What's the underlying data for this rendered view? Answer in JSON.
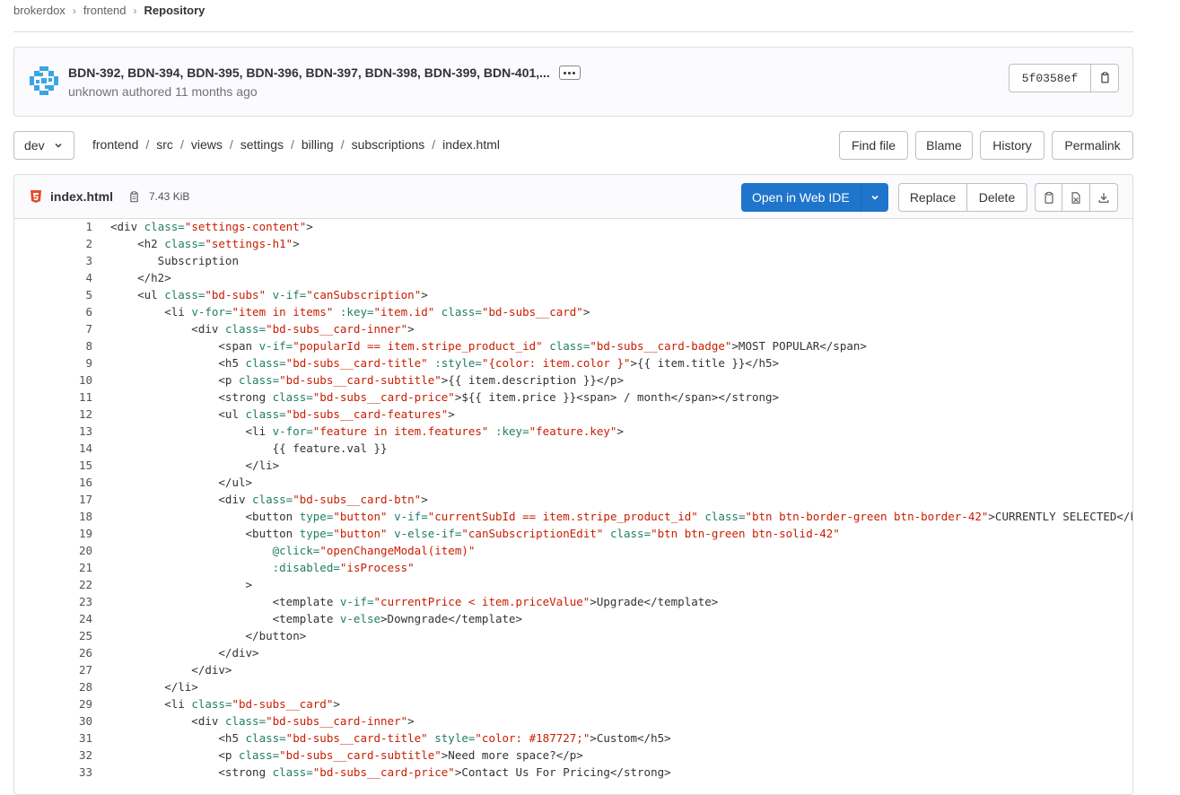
{
  "breadcrumbs": [
    "brokerdox",
    "frontend",
    "Repository"
  ],
  "commit": {
    "title": "BDN-392, BDN-394, BDN-395, BDN-396, BDN-397, BDN-398, BDN-399, BDN-401,...",
    "author_line": "unknown authored 11 months ago",
    "sha": "5f0358ef"
  },
  "nav": {
    "branch": "dev",
    "path": [
      "frontend",
      "src",
      "views",
      "settings",
      "billing",
      "subscriptions",
      "index.html"
    ],
    "buttons": {
      "find": "Find file",
      "blame": "Blame",
      "history": "History",
      "permalink": "Permalink"
    }
  },
  "file": {
    "name": "index.html",
    "size": "7.43 KiB",
    "open_ide": "Open in Web IDE",
    "replace": "Replace",
    "delete": "Delete"
  },
  "colors": {
    "primary": "#1f75cb",
    "tag": "#333238",
    "attr": "#1f7d66",
    "value": "#c91c00"
  },
  "lines": [
    [
      [
        "t",
        "<div "
      ],
      [
        "a",
        "class="
      ],
      [
        "v",
        "\"settings-content\""
      ],
      [
        "t",
        ">"
      ]
    ],
    [
      [
        "t",
        "    <h2 "
      ],
      [
        "a",
        "class="
      ],
      [
        "v",
        "\"settings-h1\""
      ],
      [
        "t",
        ">"
      ]
    ],
    [
      [
        "t",
        "       Subscription"
      ]
    ],
    [
      [
        "t",
        "    </h2>"
      ]
    ],
    [
      [
        "t",
        "    <ul "
      ],
      [
        "a",
        "class="
      ],
      [
        "v",
        "\"bd-subs\""
      ],
      [
        "t",
        " "
      ],
      [
        "a",
        "v-if="
      ],
      [
        "v",
        "\"canSubscription\""
      ],
      [
        "t",
        ">"
      ]
    ],
    [
      [
        "t",
        "        <li "
      ],
      [
        "a",
        "v-for="
      ],
      [
        "v",
        "\"item in items\""
      ],
      [
        "t",
        " "
      ],
      [
        "a",
        ":key="
      ],
      [
        "v",
        "\"item.id\""
      ],
      [
        "t",
        " "
      ],
      [
        "a",
        "class="
      ],
      [
        "v",
        "\"bd-subs__card\""
      ],
      [
        "t",
        ">"
      ]
    ],
    [
      [
        "t",
        "            <div "
      ],
      [
        "a",
        "class="
      ],
      [
        "v",
        "\"bd-subs__card-inner\""
      ],
      [
        "t",
        ">"
      ]
    ],
    [
      [
        "t",
        "                <span "
      ],
      [
        "a",
        "v-if="
      ],
      [
        "v",
        "\"popularId == item.stripe_product_id\""
      ],
      [
        "t",
        " "
      ],
      [
        "a",
        "class="
      ],
      [
        "v",
        "\"bd-subs__card-badge\""
      ],
      [
        "t",
        ">MOST POPULAR</span>"
      ]
    ],
    [
      [
        "t",
        "                <h5 "
      ],
      [
        "a",
        "class="
      ],
      [
        "v",
        "\"bd-subs__card-title\""
      ],
      [
        "t",
        " "
      ],
      [
        "a",
        ":style="
      ],
      [
        "v",
        "\"{color: item.color }\""
      ],
      [
        "t",
        ">{{ item.title }}</h5>"
      ]
    ],
    [
      [
        "t",
        "                <p "
      ],
      [
        "a",
        "class="
      ],
      [
        "v",
        "\"bd-subs__card-subtitle\""
      ],
      [
        "t",
        ">{{ item.description }}</p>"
      ]
    ],
    [
      [
        "t",
        "                <strong "
      ],
      [
        "a",
        "class="
      ],
      [
        "v",
        "\"bd-subs__card-price\""
      ],
      [
        "t",
        ">${{ item.price }}<span> / month</span></strong>"
      ]
    ],
    [
      [
        "t",
        "                <ul "
      ],
      [
        "a",
        "class="
      ],
      [
        "v",
        "\"bd-subs__card-features\""
      ],
      [
        "t",
        ">"
      ]
    ],
    [
      [
        "t",
        "                    <li "
      ],
      [
        "a",
        "v-for="
      ],
      [
        "v",
        "\"feature in item.features\""
      ],
      [
        "t",
        " "
      ],
      [
        "a",
        ":key="
      ],
      [
        "v",
        "\"feature.key\""
      ],
      [
        "t",
        ">"
      ]
    ],
    [
      [
        "t",
        "                        {{ feature.val }}"
      ]
    ],
    [
      [
        "t",
        "                    </li>"
      ]
    ],
    [
      [
        "t",
        "                </ul>"
      ]
    ],
    [
      [
        "t",
        "                <div "
      ],
      [
        "a",
        "class="
      ],
      [
        "v",
        "\"bd-subs__card-btn\""
      ],
      [
        "t",
        ">"
      ]
    ],
    [
      [
        "t",
        "                    <button "
      ],
      [
        "a",
        "type="
      ],
      [
        "v",
        "\"button\""
      ],
      [
        "t",
        " "
      ],
      [
        "a",
        "v-if="
      ],
      [
        "v",
        "\"currentSubId == item.stripe_product_id\""
      ],
      [
        "t",
        " "
      ],
      [
        "a",
        "class="
      ],
      [
        "v",
        "\"btn btn-border-green btn-border-42\""
      ],
      [
        "t",
        ">CURRENTLY SELECTED</button>"
      ]
    ],
    [
      [
        "t",
        "                    <button "
      ],
      [
        "a",
        "type="
      ],
      [
        "v",
        "\"button\""
      ],
      [
        "t",
        " "
      ],
      [
        "a",
        "v-else-if="
      ],
      [
        "v",
        "\"canSubscriptionEdit\""
      ],
      [
        "t",
        " "
      ],
      [
        "a",
        "class="
      ],
      [
        "v",
        "\"btn btn-green btn-solid-42\""
      ]
    ],
    [
      [
        "t",
        "                        "
      ],
      [
        "a",
        "@click="
      ],
      [
        "v",
        "\"openChangeModal(item)\""
      ]
    ],
    [
      [
        "t",
        "                        "
      ],
      [
        "a",
        ":disabled="
      ],
      [
        "v",
        "\"isProcess\""
      ]
    ],
    [
      [
        "t",
        "                    >"
      ]
    ],
    [
      [
        "t",
        "                        <template "
      ],
      [
        "a",
        "v-if="
      ],
      [
        "v",
        "\"currentPrice < item.priceValue\""
      ],
      [
        "t",
        ">Upgrade</template>"
      ]
    ],
    [
      [
        "t",
        "                        <template "
      ],
      [
        "a",
        "v-else"
      ],
      [
        "t",
        ">Downgrade</template>"
      ]
    ],
    [
      [
        "t",
        "                    </button>"
      ]
    ],
    [
      [
        "t",
        "                </div>"
      ]
    ],
    [
      [
        "t",
        "            </div>"
      ]
    ],
    [
      [
        "t",
        "        </li>"
      ]
    ],
    [
      [
        "t",
        "        <li "
      ],
      [
        "a",
        "class="
      ],
      [
        "v",
        "\"bd-subs__card\""
      ],
      [
        "t",
        ">"
      ]
    ],
    [
      [
        "t",
        "            <div "
      ],
      [
        "a",
        "class="
      ],
      [
        "v",
        "\"bd-subs__card-inner\""
      ],
      [
        "t",
        ">"
      ]
    ],
    [
      [
        "t",
        "                <h5 "
      ],
      [
        "a",
        "class="
      ],
      [
        "v",
        "\"bd-subs__card-title\""
      ],
      [
        "t",
        " "
      ],
      [
        "a",
        "style="
      ],
      [
        "v",
        "\"color: #187727;\""
      ],
      [
        "t",
        ">Custom</h5>"
      ]
    ],
    [
      [
        "t",
        "                <p "
      ],
      [
        "a",
        "class="
      ],
      [
        "v",
        "\"bd-subs__card-subtitle\""
      ],
      [
        "t",
        ">Need more space?</p>"
      ]
    ],
    [
      [
        "t",
        "                <strong "
      ],
      [
        "a",
        "class="
      ],
      [
        "v",
        "\"bd-subs__card-price\""
      ],
      [
        "t",
        ">Contact Us For Pricing</strong>"
      ]
    ]
  ]
}
